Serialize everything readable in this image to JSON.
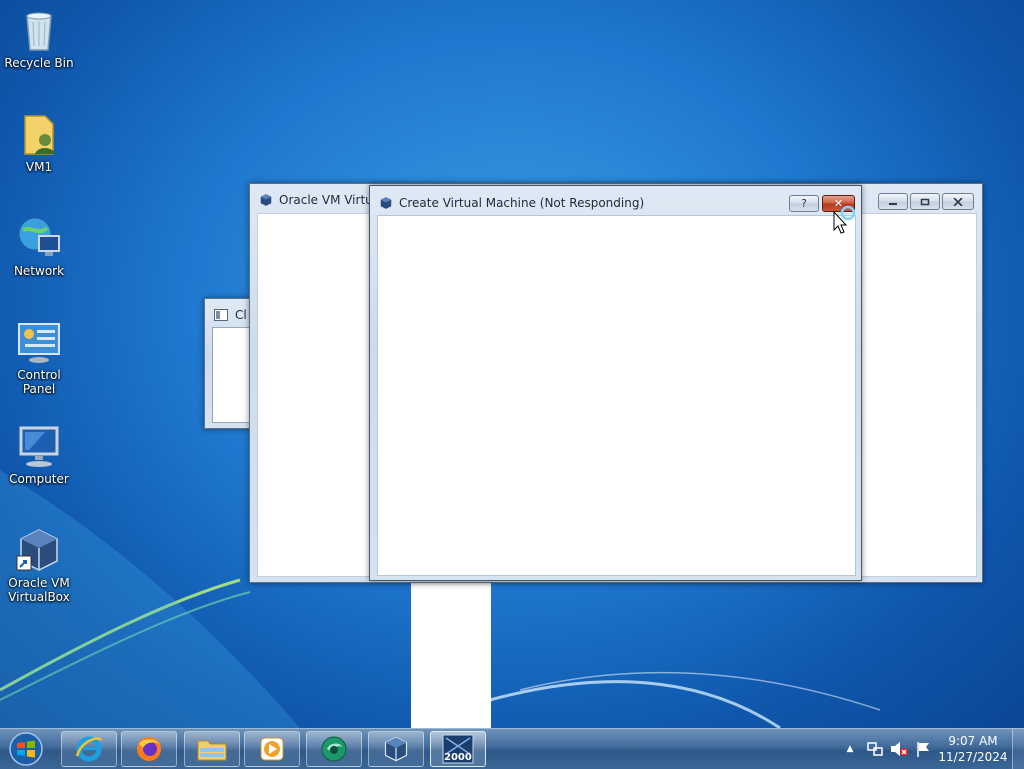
{
  "desktop": {
    "icons": [
      {
        "label": "Recycle Bin",
        "icon": "recycle-bin-icon"
      },
      {
        "label": "VM1",
        "icon": "user-folder-icon"
      },
      {
        "label": "Network",
        "icon": "network-icon"
      },
      {
        "label": "Control Panel",
        "icon": "control-panel-icon"
      },
      {
        "label": "Computer",
        "icon": "computer-icon"
      },
      {
        "label": "Oracle VM\nVirtualBox",
        "icon": "virtualbox-shortcut-icon"
      }
    ]
  },
  "windows": {
    "virtualbox_manager": {
      "title": "Oracle VM Virtual",
      "icon": "virtualbox-icon"
    },
    "background_window": {
      "title": "Cl",
      "icon": "window-icon"
    },
    "create_vm_dialog": {
      "title": "Create Virtual Machine (Not Responding)",
      "icon": "virtualbox-icon",
      "help_label": "?",
      "close_label": "✕"
    }
  },
  "taskbar": {
    "start_icon": "windows-start-orb-icon",
    "pinned": [
      {
        "name": "internet-explorer",
        "icon": "internet-explorer-icon"
      },
      {
        "name": "firefox",
        "icon": "firefox-icon"
      },
      {
        "name": "file-explorer",
        "icon": "folder-icon"
      },
      {
        "name": "media-player",
        "icon": "media-player-icon"
      },
      {
        "name": "green-app",
        "icon": "green-app-icon"
      },
      {
        "name": "virtualbox",
        "icon": "virtualbox-icon"
      },
      {
        "name": "windows-2000-vm",
        "icon": "windows-2000-icon",
        "badge": "2000"
      }
    ],
    "tray": {
      "show_hidden": "▲",
      "icons": [
        "network-tray-icon",
        "volume-muted-icon",
        "action-center-flag-icon"
      ],
      "time": "9:07 AM",
      "date": "11/27/2024"
    }
  },
  "colors": {
    "desktop_blue": "#1f78cf",
    "taskbar": "#3f6a9a",
    "close_red": "#cf5a3e",
    "window_frame": "#cddceb"
  }
}
